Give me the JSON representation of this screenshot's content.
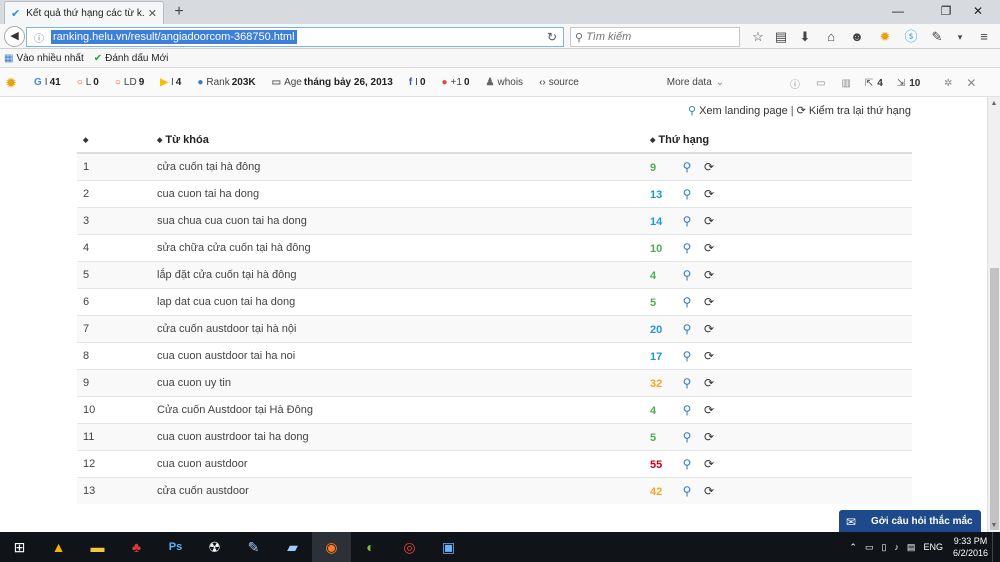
{
  "browser": {
    "tab_title": "Kết quả thứ hạng các từ k...",
    "url": "ranking.helu.vn/result/angiadoorcom-368750.html",
    "search_placeholder": "Tìm kiếm"
  },
  "bookmarks": [
    {
      "label": "Vào nhiều nhất",
      "icon": "most-visited-icon"
    },
    {
      "label": "Đánh dấu Mới",
      "icon": "bookmark-check-icon"
    }
  ],
  "seo_toolbar": {
    "google_index": {
      "label": "I",
      "value": "41"
    },
    "links": {
      "label": "L",
      "value": "0"
    },
    "linking_domains": {
      "label": "LD",
      "value": "9"
    },
    "bing_index": {
      "label": "I",
      "value": "4"
    },
    "rank": {
      "label": "Rank",
      "value": "203K"
    },
    "age": {
      "label": "Age",
      "value": "tháng bảy 26, 2013"
    },
    "facebook": {
      "label": "I",
      "value": "0"
    },
    "gplus": {
      "label": "+1",
      "value": "0"
    },
    "whois": "whois",
    "source": "source",
    "more_data": "More data",
    "external_links": "4",
    "internal_links": "10"
  },
  "actions": {
    "view_landing": "Xem landing page",
    "separator": "|",
    "recheck": "Kiểm tra lại thứ hạng"
  },
  "table": {
    "headers": {
      "col_index": "",
      "col_keyword": "Từ khóa",
      "col_rank": "Thứ hạng"
    },
    "rows": [
      {
        "index": "1",
        "keyword": "cửa cuốn tại hà đông",
        "rank": "9",
        "rank_color": "#4caf50"
      },
      {
        "index": "2",
        "keyword": "cua cuon tai ha dong",
        "rank": "13",
        "rank_color": "#2196d3"
      },
      {
        "index": "3",
        "keyword": "sua chua cua cuon tai ha dong",
        "rank": "14",
        "rank_color": "#2196d3"
      },
      {
        "index": "4",
        "keyword": "sửa chữa cửa cuốn tại hà đông",
        "rank": "10",
        "rank_color": "#4caf50"
      },
      {
        "index": "5",
        "keyword": "lắp đặt cửa cuốn tại hà đông",
        "rank": "4",
        "rank_color": "#4caf50"
      },
      {
        "index": "6",
        "keyword": "lap dat cua cuon tai ha dong",
        "rank": "5",
        "rank_color": "#4caf50"
      },
      {
        "index": "7",
        "keyword": "cửa cuốn austdoor tại hà nội",
        "rank": "20",
        "rank_color": "#2196d3"
      },
      {
        "index": "8",
        "keyword": "cua cuon austdoor tai ha noi",
        "rank": "17",
        "rank_color": "#2196d3"
      },
      {
        "index": "9",
        "keyword": "cua cuon uy tin",
        "rank": "32",
        "rank_color": "#f5a623"
      },
      {
        "index": "10",
        "keyword": "Cửa cuốn Austdoor tại Hà Đông",
        "rank": "4",
        "rank_color": "#4caf50"
      },
      {
        "index": "11",
        "keyword": "cua cuon austrdoor tai ha dong",
        "rank": "5",
        "rank_color": "#4caf50"
      },
      {
        "index": "12",
        "keyword": "cua cuon austdoor",
        "rank": "55",
        "rank_color": "#d0021b"
      },
      {
        "index": "13",
        "keyword": "cửa cuốn austdoor",
        "rank": "42",
        "rank_color": "#f5a623"
      }
    ]
  },
  "chat_widget": {
    "label": "Gởi câu hỏi thắc mắc"
  },
  "taskbar": {
    "language": "ENG",
    "time": "9:33 PM",
    "date": "6/2/2016"
  }
}
